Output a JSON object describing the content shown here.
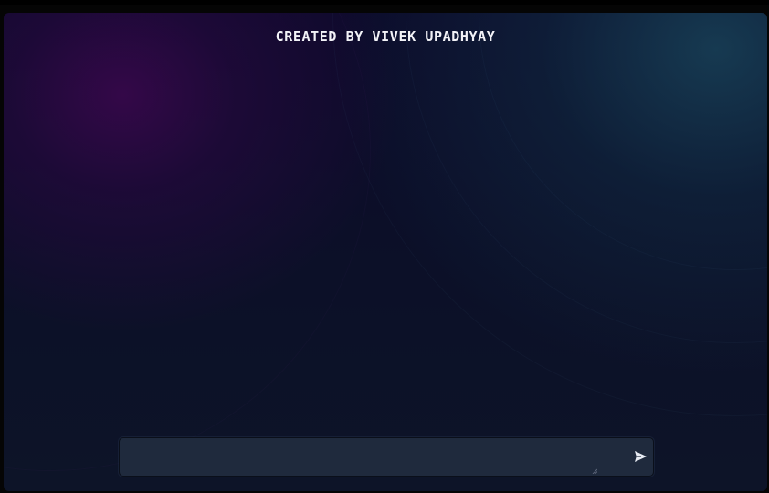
{
  "app": {
    "title": "CREATED BY VIVEK UPADHYAY"
  },
  "composer": {
    "input_value": "",
    "input_placeholder": "",
    "send_icon": "send-icon",
    "grip_icon": "resize-grip-icon"
  },
  "colors": {
    "title_text": "#f2f2f7",
    "composer_bg": "#1f2a3d",
    "send_icon": "#e8ecf4",
    "bg_purple": "#36084a",
    "bg_teal": "#184258",
    "bg_base": "#0c1028"
  }
}
